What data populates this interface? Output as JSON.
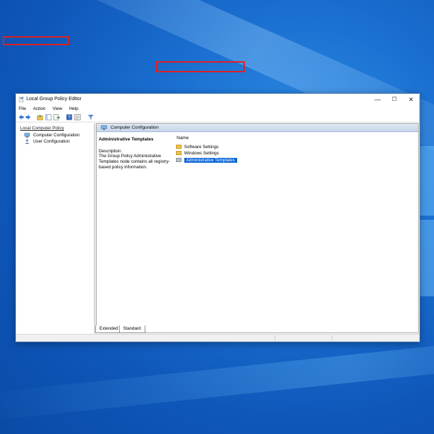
{
  "window": {
    "title": "Local Group Policy Editor",
    "controls": {
      "minimize": "—",
      "maximize": "☐",
      "close": "✕"
    }
  },
  "menu": [
    "File",
    "Action",
    "View",
    "Help"
  ],
  "toolbar": {
    "icons": [
      "back-arrow-icon",
      "forward-arrow-icon",
      "folder-up-icon",
      "show-hide-tree-icon",
      "export-list-icon",
      "help-icon",
      "properties-icon",
      "filter-icon"
    ]
  },
  "tree": {
    "root": "Local Computer Policy",
    "children": [
      "Computer Configuration",
      "User Configuration"
    ]
  },
  "details": {
    "header": "Computer Configuration",
    "selected_title": "Administrative Templates",
    "description_label": "Description:",
    "description_text": "The Group Policy Administrative Templates node contains all registry-based policy information.",
    "column_name": "Name",
    "items": [
      "Software Settings",
      "Windows Settings",
      "Administrative Templates"
    ]
  },
  "tabs": [
    "Extended",
    "Standard"
  ],
  "colors": {
    "highlight_box": "#e01f1f",
    "selection": "#0a64d6",
    "header_bar": "#c6d6ea"
  }
}
